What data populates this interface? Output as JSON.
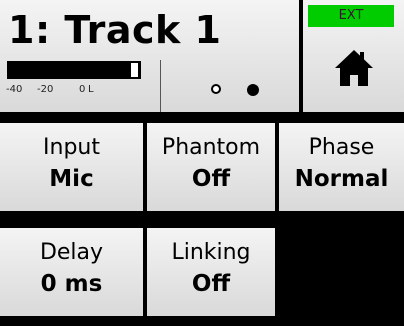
{
  "header": {
    "title": "1: Track 1",
    "meter": {
      "level_fraction": 0.9,
      "scale": [
        "-40",
        "-20",
        "0",
        "L"
      ]
    },
    "page_indicator": {
      "total": 2,
      "current": 2
    }
  },
  "home": {
    "sync_badge": "EXT",
    "icon": "home-icon"
  },
  "settings": {
    "input": {
      "label": "Input",
      "value": "Mic"
    },
    "phantom": {
      "label": "Phantom",
      "value": "Off"
    },
    "phase": {
      "label": "Phase",
      "value": "Normal"
    },
    "delay": {
      "label": "Delay",
      "value": "0 ms"
    },
    "linking": {
      "label": "Linking",
      "value": "Off"
    }
  },
  "colors": {
    "badge_green": "#00cc00",
    "background": "#000000"
  }
}
